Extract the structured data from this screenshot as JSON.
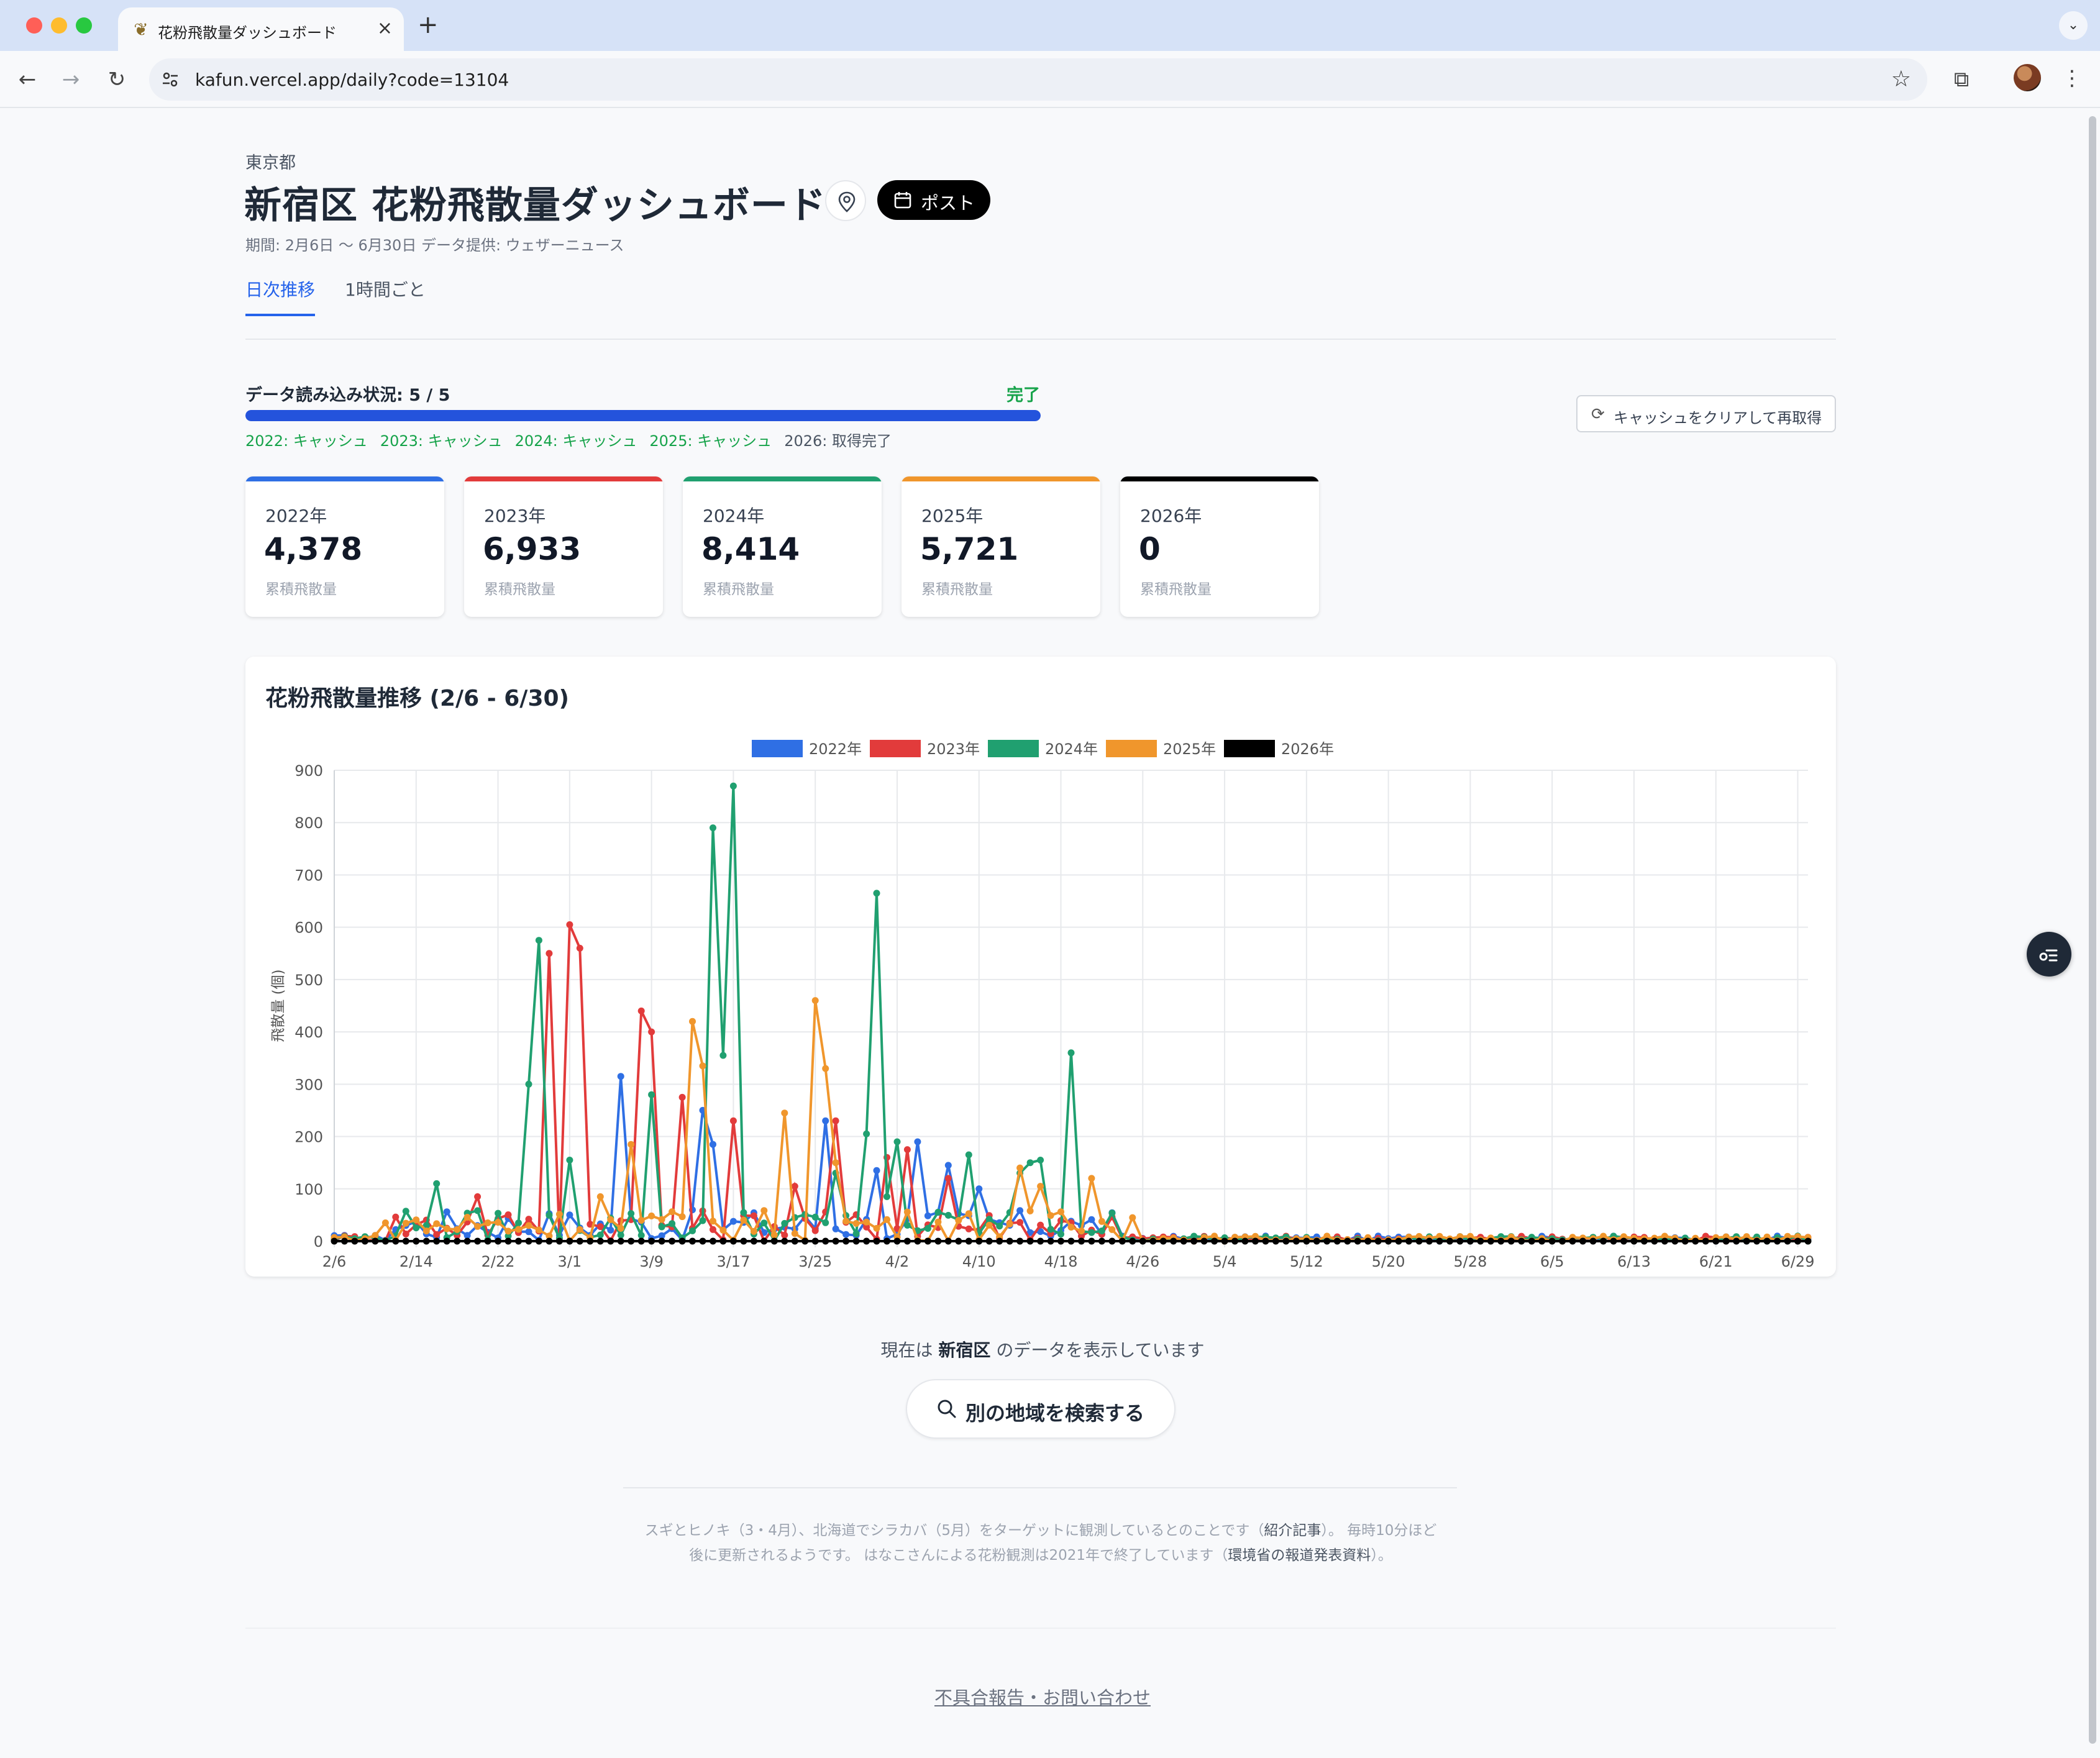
{
  "browser": {
    "tab_title": "花粉飛散量ダッシュボード",
    "url": "kafun.vercel.app/daily?code=13104"
  },
  "header": {
    "prefecture": "東京都",
    "title": "新宿区 花粉飛散量ダッシュボード",
    "post_label": "ポスト",
    "period": "期間: 2月6日 〜 6月30日 データ提供: ウェザーニュース"
  },
  "tabs": [
    {
      "label": "日次推移",
      "active": true
    },
    {
      "label": "1時間ごと",
      "active": false
    }
  ],
  "loading": {
    "label": "データ読み込み状況: 5 / 5",
    "status": "完了",
    "progress": 1.0,
    "items": [
      {
        "text": "2022: キャッシュ",
        "state": "cached"
      },
      {
        "text": "2023: キャッシュ",
        "state": "cached"
      },
      {
        "text": "2024: キャッシュ",
        "state": "cached"
      },
      {
        "text": "2025: キャッシュ",
        "state": "cached"
      },
      {
        "text": "2026: 取得完了",
        "state": "done"
      }
    ],
    "clear_cache_label": "キャッシュをクリアして再取得"
  },
  "summary_cards": [
    {
      "year": "2022年",
      "value": "4,378",
      "sub": "累積飛散量",
      "color": "#2f6fe4"
    },
    {
      "year": "2023年",
      "value": "6,933",
      "sub": "累積飛散量",
      "color": "#e23b3b"
    },
    {
      "year": "2024年",
      "value": "8,414",
      "sub": "累積飛散量",
      "color": "#20a070"
    },
    {
      "year": "2025年",
      "value": "5,721",
      "sub": "累積飛散量",
      "color": "#f0962c"
    },
    {
      "year": "2026年",
      "value": "0",
      "sub": "累積飛散量",
      "color": "#000000"
    }
  ],
  "chart_title": "花粉飛散量推移 (2/6 - 6/30)",
  "chart_data": {
    "type": "line",
    "title": "花粉飛散量推移 (2/6 - 6/30)",
    "ylabel": "飛散量 (個)",
    "xlabel": "",
    "ylim": [
      0,
      900
    ],
    "yticks": [
      0,
      100,
      200,
      300,
      400,
      500,
      600,
      700,
      800,
      900
    ],
    "x_tick_labels": [
      "2/6",
      "2/14",
      "2/22",
      "3/1",
      "3/9",
      "3/17",
      "3/25",
      "4/2",
      "4/10",
      "4/18",
      "4/26",
      "5/4",
      "5/12",
      "5/20",
      "5/28",
      "6/5",
      "6/13",
      "6/21",
      "6/29"
    ],
    "x_start": "2/6",
    "x_end": "6/30",
    "legend_position": "top",
    "grid": true,
    "series": [
      {
        "name": "2022年",
        "color": "#2f6fe4",
        "peaks": [
          {
            "date": "3/6",
            "value": 315
          },
          {
            "date": "3/14",
            "value": 250
          },
          {
            "date": "3/15",
            "value": 185
          },
          {
            "date": "3/26",
            "value": 230
          },
          {
            "date": "3/31",
            "value": 135
          },
          {
            "date": "4/4",
            "value": 190
          },
          {
            "date": "4/7",
            "value": 145
          },
          {
            "date": "4/10",
            "value": 100
          },
          {
            "date": "4/20",
            "value": 30
          }
        ]
      },
      {
        "name": "2023年",
        "color": "#e23b3b",
        "peaks": [
          {
            "date": "2/20",
            "value": 85
          },
          {
            "date": "2/27",
            "value": 550
          },
          {
            "date": "3/1",
            "value": 605
          },
          {
            "date": "3/2",
            "value": 560
          },
          {
            "date": "3/8",
            "value": 440
          },
          {
            "date": "3/9",
            "value": 400
          },
          {
            "date": "3/12",
            "value": 275
          },
          {
            "date": "3/17",
            "value": 230
          },
          {
            "date": "3/23",
            "value": 105
          },
          {
            "date": "3/27",
            "value": 230
          },
          {
            "date": "4/1",
            "value": 160
          },
          {
            "date": "4/3",
            "value": 175
          },
          {
            "date": "4/7",
            "value": 120
          }
        ]
      },
      {
        "name": "2024年",
        "color": "#20a070",
        "peaks": [
          {
            "date": "2/15",
            "value": 30
          },
          {
            "date": "2/16",
            "value": 110
          },
          {
            "date": "2/25",
            "value": 300
          },
          {
            "date": "2/26",
            "value": 575
          },
          {
            "date": "3/1",
            "value": 155
          },
          {
            "date": "3/9",
            "value": 280
          },
          {
            "date": "3/15",
            "value": 790
          },
          {
            "date": "3/16",
            "value": 355
          },
          {
            "date": "3/17",
            "value": 870
          },
          {
            "date": "3/27",
            "value": 130
          },
          {
            "date": "3/30",
            "value": 205
          },
          {
            "date": "3/31",
            "value": 665
          },
          {
            "date": "4/1",
            "value": 85
          },
          {
            "date": "4/2",
            "value": 190
          },
          {
            "date": "4/9",
            "value": 165
          },
          {
            "date": "4/14",
            "value": 130
          },
          {
            "date": "4/15",
            "value": 150
          },
          {
            "date": "4/16",
            "value": 155
          },
          {
            "date": "4/19",
            "value": 360
          }
        ]
      },
      {
        "name": "2025年",
        "color": "#f0962c",
        "peaks": [
          {
            "date": "2/11",
            "value": 35
          },
          {
            "date": "3/4",
            "value": 85
          },
          {
            "date": "3/7",
            "value": 185
          },
          {
            "date": "3/13",
            "value": 420
          },
          {
            "date": "3/14",
            "value": 335
          },
          {
            "date": "3/22",
            "value": 245
          },
          {
            "date": "3/25",
            "value": 460
          },
          {
            "date": "3/26",
            "value": 330
          },
          {
            "date": "3/27",
            "value": 150
          },
          {
            "date": "4/14",
            "value": 140
          },
          {
            "date": "4/16",
            "value": 105
          },
          {
            "date": "4/21",
            "value": 120
          },
          {
            "date": "4/25",
            "value": 45
          }
        ]
      },
      {
        "name": "2026年",
        "color": "#000000",
        "peaks": []
      }
    ]
  },
  "footer": {
    "current_prefix": "現在は ",
    "current_area": "新宿区",
    "current_suffix": " のデータを表示しています",
    "search_label": "別の地域を検索する",
    "note_line1_a": "スギとヒノキ（3・4月）、北海道でシラカバ（5月）をターゲットに観測しているとのことです（",
    "note_link1": "紹介記事",
    "note_line1_b": "）。 毎時10分ほど",
    "note_line2_a": "後に更新されるようです。 はなこさんによる花粉観測は2021年で終了しています（",
    "note_link2": "環境省の報道発表資料",
    "note_line2_b": "）。",
    "report_link": "不具合報告・お問い合わせ"
  }
}
